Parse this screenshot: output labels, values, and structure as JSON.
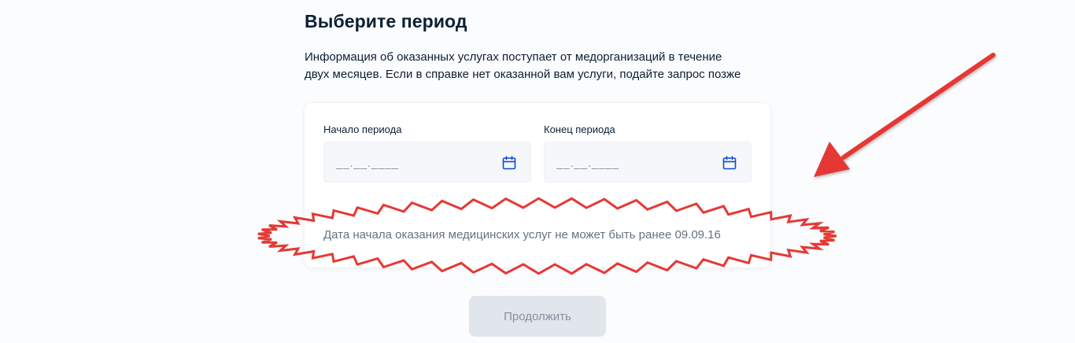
{
  "page": {
    "title": "Выберите период",
    "description_line1": "Информация об оказанных услугах поступает от медорганизаций в течение",
    "description_line2": "двух месяцев. Если в справке нет оказанной вам услуги, подайте запрос позже"
  },
  "form": {
    "start": {
      "label": "Начало периода",
      "placeholder": "__.__.____",
      "value": "",
      "icon": "calendar-icon"
    },
    "end": {
      "label": "Конец периода",
      "placeholder": "__.__.____",
      "value": "",
      "icon": "calendar-icon"
    },
    "hint": "Дата начала оказания медицинских услуг не может быть ранее 09.09.16"
  },
  "actions": {
    "continue_label": "Продолжить",
    "continue_disabled": true
  },
  "annotations": {
    "highlight_color": "#e53935",
    "arrow_color": "#e53935"
  },
  "colors": {
    "accent": "#0d4cd3",
    "text": "#0b1f33",
    "muted": "#66727f",
    "field_bg": "#f5f7fa"
  }
}
